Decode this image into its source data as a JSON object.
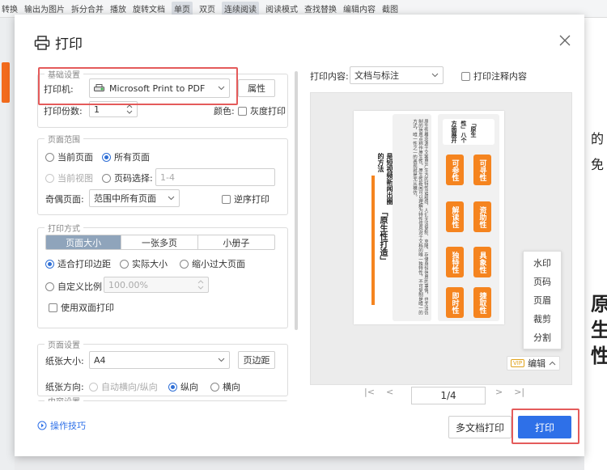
{
  "background": {
    "toolbar_items": [
      "转换",
      "输出为图片",
      "拆分合并",
      "播放",
      "旋转文档",
      "单页",
      "双页",
      "连续阅读",
      "阅读模式",
      "查找替换",
      "编辑内容",
      "截图"
    ],
    "right_edge_text": [
      "的",
      "免",
      "原",
      "生",
      "性"
    ]
  },
  "dialog": {
    "title": "打印",
    "basic": {
      "legend": "基础设置",
      "printer_label": "打印机:",
      "printer_value": "Microsoft Print to PDF",
      "properties_button": "属性",
      "copies_label": "打印份数:",
      "copies_value": "1",
      "color_label": "颜色:",
      "gray_label": "灰度打印"
    },
    "range": {
      "legend": "页面范围",
      "current_page": "当前页面",
      "all_pages": "所有页面",
      "current_view": "当前视图",
      "page_select": "页码选择:",
      "page_select_placeholder": "1-4",
      "odd_even_label": "奇偶页面:",
      "odd_even_value": "范围中所有页面",
      "reverse_label": "逆序打印"
    },
    "mode": {
      "legend": "打印方式",
      "tabs": [
        "页面大小",
        "一张多页",
        "小册子"
      ],
      "fit_margin": "适合打印边距",
      "actual_size": "实际大小",
      "shrink": "缩小过大页面",
      "custom_scale": "自定义比例",
      "scale_value": "100.00%",
      "duplex": "使用双面打印"
    },
    "page_setup": {
      "legend": "页面设置",
      "paper_label": "纸张大小:",
      "paper_value": "A4",
      "margin_button": "页边距",
      "orient_label": "纸张方向:",
      "auto": "自动横向/纵向",
      "portrait": "纵向",
      "landscape": "横向"
    },
    "content_legend": "内容设置",
    "tips_link": "操作技巧",
    "print_content_label": "打印内容:",
    "print_content_value": "文档与标注",
    "print_comments_label": "打印注释内容",
    "preview": {
      "title_main": "「原生性打造」",
      "title_sub": "是短视频新闻出圈的方法",
      "body_text": "原生性概念源于文案界产生方的特性话题感，人们无法复制、克隆、存储身份信息的事情，也无法仿制的信息点称作原生性。原生性新闻可以理解为特性信息对于文档的唯一独特性，不可复制是唯一的方式，唯一性之一的表现就是无从模仿。",
      "header_text": "「原生性」八个方面展开",
      "boxes": [
        "可参性",
        "可寻性",
        "解读性",
        "资助性",
        "独特性",
        "具象性",
        "即时性",
        "捷取性"
      ]
    },
    "context_menu": [
      "水印",
      "页码",
      "页眉",
      "裁剪",
      "分割"
    ],
    "vip_badge": "VIP",
    "edit_label": "编辑",
    "page_indicator": "1/4",
    "multi_print_button": "多文档打印",
    "print_button": "打印"
  },
  "colors": {
    "accent_blue": "#2e70e8",
    "highlight_red": "#e45b5b",
    "orange": "#f5841f"
  }
}
